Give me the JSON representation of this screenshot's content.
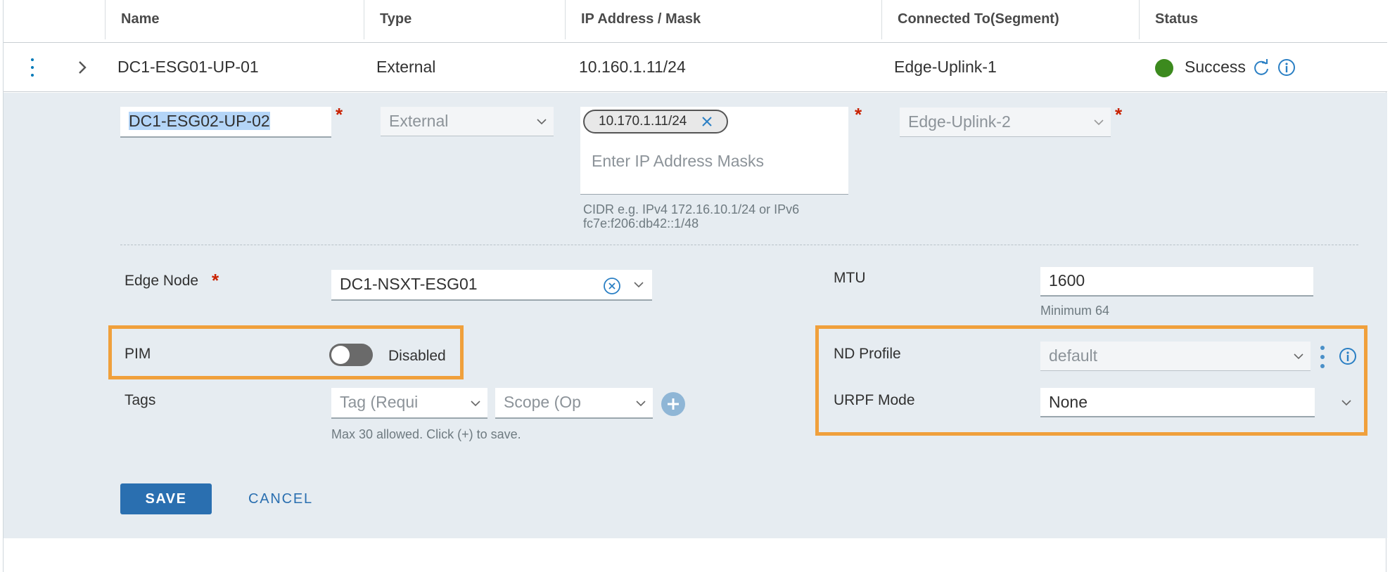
{
  "table": {
    "headers": [
      "Name",
      "Type",
      "IP Address / Mask",
      "Connected To(Segment)",
      "Status"
    ],
    "row": {
      "name": "DC1-ESG01-UP-01",
      "type": "External",
      "ip": "10.160.1.11/24",
      "segment": "Edge-Uplink-1",
      "status": "Success",
      "status_color": "#3c8a1e"
    }
  },
  "edit": {
    "name_value": "DC1-ESG02-UP-02",
    "type_value": "External",
    "ip_chip": "10.170.1.11/24",
    "ip_placeholder": "Enter IP Address Masks",
    "ip_hint_line1": "CIDR e.g. IPv4 172.16.10.1/24 or IPv6",
    "ip_hint_line2": "fc7e:f206:db42::1/48",
    "segment_value": "Edge-Uplink-2",
    "edge_node_label": "Edge Node",
    "edge_node_value": "DC1-NSXT-ESG01",
    "mtu_label": "MTU",
    "mtu_value": "1600",
    "mtu_hint": "Minimum 64",
    "pim_label": "PIM",
    "pim_state": "Disabled",
    "tags_label": "Tags",
    "tag_placeholder": "Tag (Requi",
    "scope_placeholder": "Scope (Op",
    "tags_hint": "Max 30 allowed. Click (+) to save.",
    "nd_profile_label": "ND Profile",
    "nd_profile_value": "default",
    "urpf_label": "URPF Mode",
    "urpf_value": "None",
    "save_label": "SAVE",
    "cancel_label": "CANCEL"
  },
  "colors": {
    "accent": "#2a6fb0",
    "highlight": "#f0a03c",
    "required": "#c92100",
    "panel_bg": "#e6ecf1"
  },
  "icons": [
    "kebab-icon",
    "chevron-right-icon",
    "refresh-icon",
    "info-icon",
    "chevron-down-icon",
    "close-icon",
    "clear-circle-icon",
    "plus-icon"
  ]
}
